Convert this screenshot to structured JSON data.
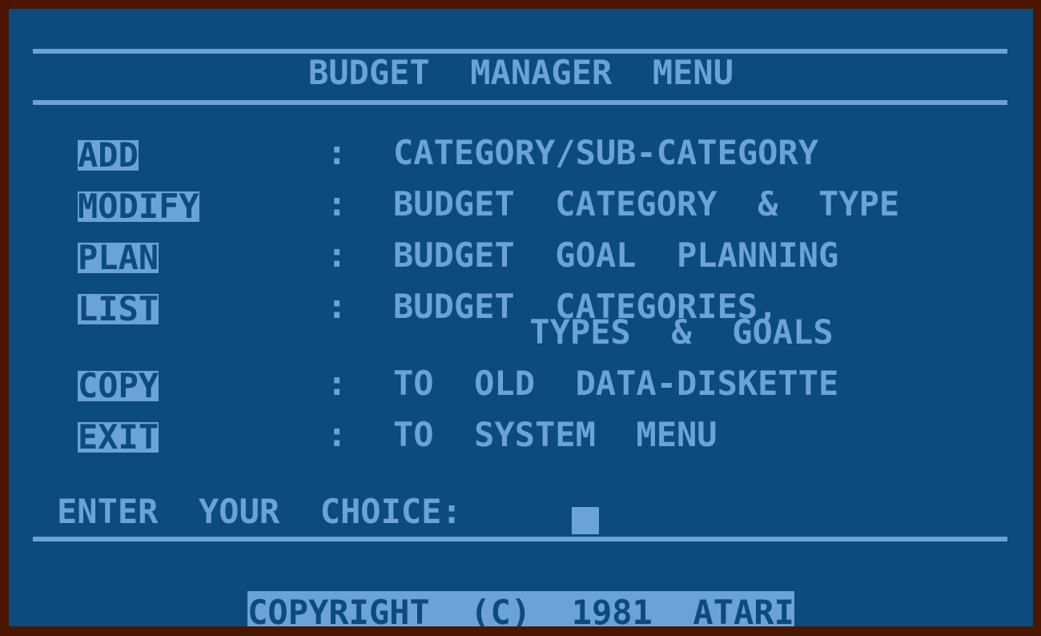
{
  "screen": {
    "title": "BUDGET  MANAGER  MENU",
    "border_color": "#4a1600",
    "background_color": "#0d4b7c",
    "foreground_color": "#6ba3d6"
  },
  "menu": {
    "separator": ":",
    "items": [
      {
        "key": "ADD",
        "separator": ":",
        "description": "CATEGORY/SUB-CATEGORY",
        "description2": ""
      },
      {
        "key": "MODIFY",
        "separator": ":",
        "description": "BUDGET  CATEGORY  &  TYPE",
        "description2": ""
      },
      {
        "key": "PLAN",
        "separator": ":",
        "description": "BUDGET  GOAL  PLANNING",
        "description2": ""
      },
      {
        "key": "LIST",
        "separator": ":",
        "description": "BUDGET  CATEGORIES,",
        "description2": "TYPES  &  GOALS"
      },
      {
        "key": "COPY",
        "separator": ":",
        "description": "TO  OLD  DATA-DISKETTE",
        "description2": ""
      },
      {
        "key": "EXIT",
        "separator": ":",
        "description": "TO  SYSTEM  MENU",
        "description2": ""
      }
    ]
  },
  "prompt": {
    "label": "ENTER  YOUR  CHOICE:",
    "value": "",
    "cursor": "block"
  },
  "footer": {
    "copyright": "COPYRIGHT  (C)  1981  ATARI"
  }
}
